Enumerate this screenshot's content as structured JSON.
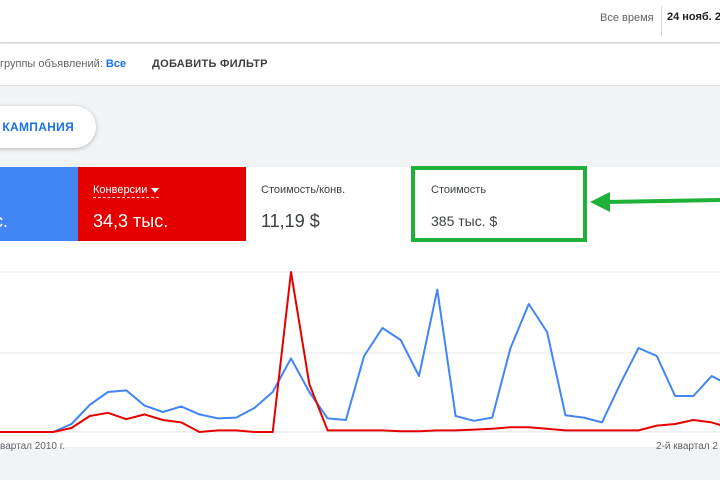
{
  "header": {
    "date_range_label": "Все время",
    "date_range_value": "24 нояб. 2"
  },
  "filters": {
    "ad_groups_label": "группы объявлений:",
    "ad_groups_value": "Все",
    "add_filter_label": "ДОБАВИТЬ ФИЛЬТР"
  },
  "campaign_button_label": "КАМПАНИЯ",
  "metrics": {
    "first_value": "с.",
    "conversions_label": "Конверсии",
    "conversions_value": "34,3 тыс.",
    "cost_per_conv_label": "Стоимость/конв.",
    "cost_per_conv_value": "11,19 $",
    "cost_label": "Стоимость",
    "cost_value": "385 тыс. $"
  },
  "colors": {
    "blue_series": "#4285f4",
    "red_series": "#e50000",
    "highlight": "#1fb138"
  },
  "chart_data": {
    "type": "line",
    "x_tick_labels": [
      "вартал 2010 г.",
      "2-й квартал 2"
    ],
    "series": [
      {
        "name": "",
        "values": [
          0,
          0,
          0,
          0,
          0,
          10,
          34,
          50,
          52,
          33,
          25,
          32,
          22,
          17,
          18,
          30,
          50,
          92,
          50,
          17,
          15,
          95,
          130,
          115,
          70,
          178,
          20,
          14,
          18,
          105,
          160,
          125,
          21,
          18,
          12,
          60,
          105,
          95,
          45,
          45,
          70,
          58
        ]
      },
      {
        "name": "",
        "values": [
          0,
          0,
          0,
          0,
          0,
          5,
          20,
          24,
          16,
          22,
          15,
          12,
          0,
          2,
          2,
          0,
          0,
          200,
          60,
          2,
          2,
          2,
          2,
          1,
          1,
          2,
          2,
          3,
          4,
          6,
          6,
          4,
          2,
          2,
          2,
          2,
          2,
          8,
          10,
          15,
          12,
          5
        ]
      }
    ]
  }
}
